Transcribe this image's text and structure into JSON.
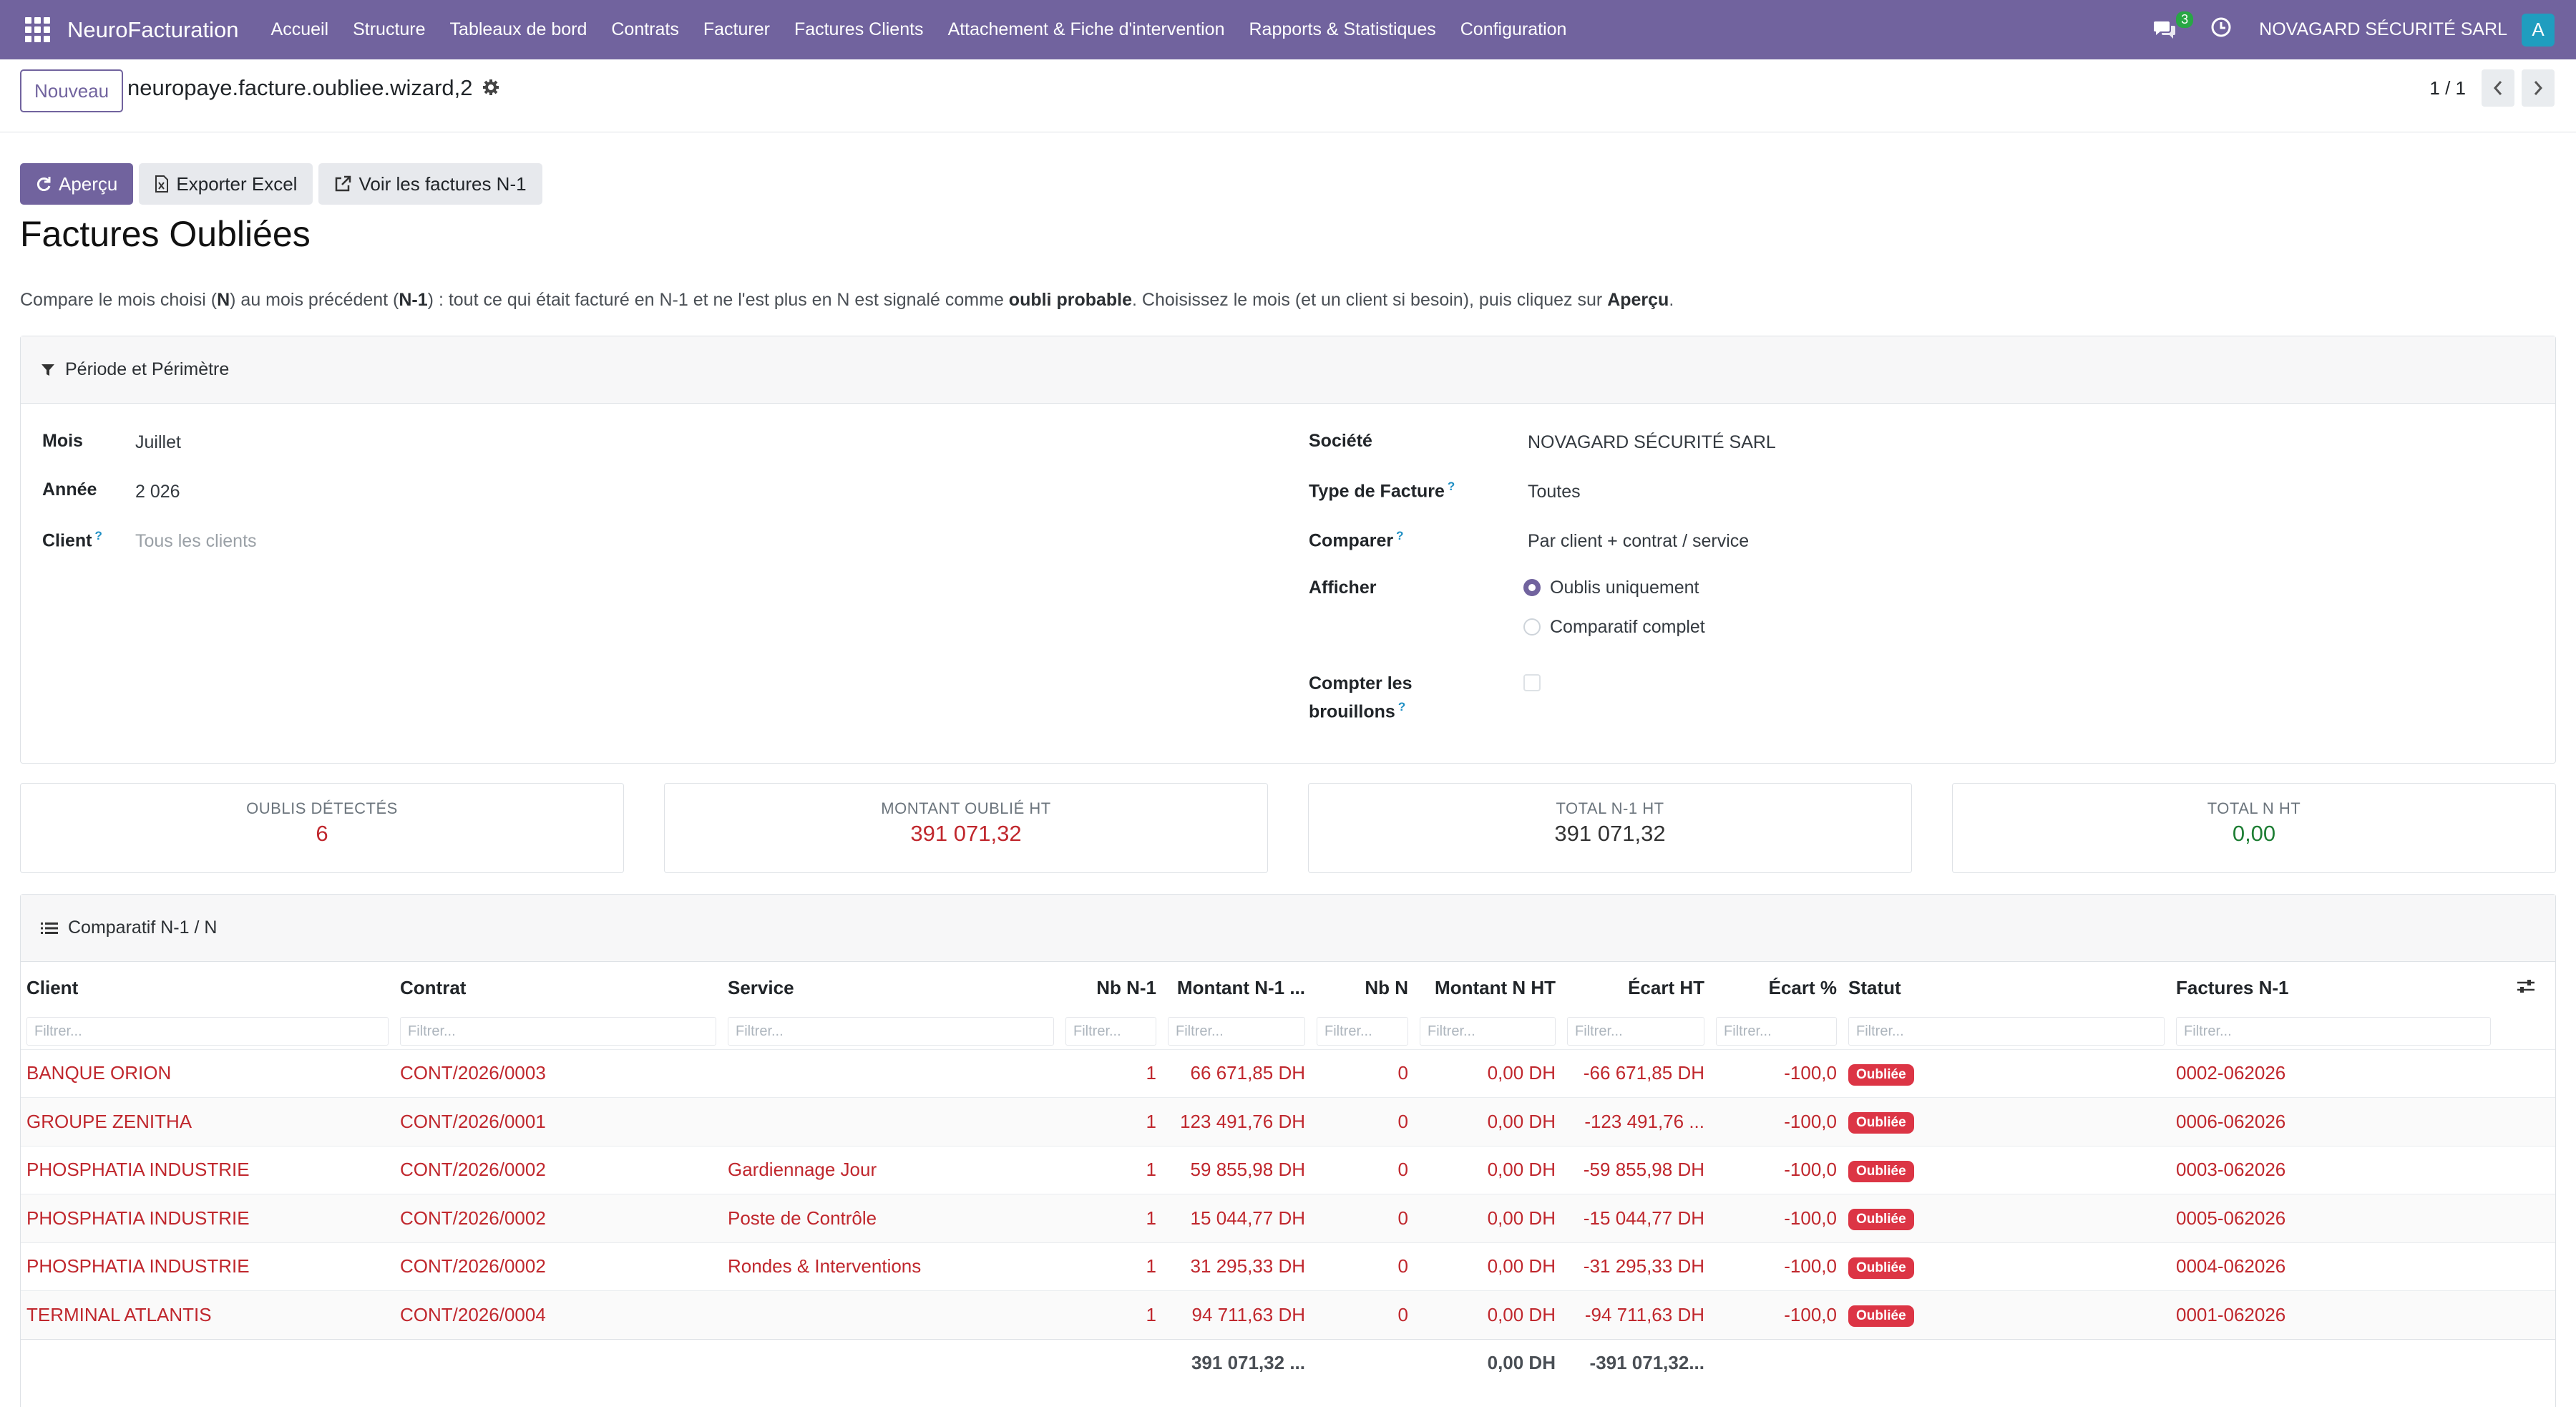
{
  "navbar": {
    "brand": "NeuroFacturation",
    "menu": [
      "Accueil",
      "Structure",
      "Tableaux de bord",
      "Contrats",
      "Facturer",
      "Factures Clients",
      "Attachement & Fiche d'intervention",
      "Rapports & Statistiques",
      "Configuration"
    ],
    "chat_count": "3",
    "company": "NOVAGARD SÉCURITÉ SARL",
    "avatar_letter": "A"
  },
  "control": {
    "new_label": "Nouveau",
    "record_name": "neuropaye.facture.oubliee.wizard,2",
    "pager": "1 / 1"
  },
  "actions": {
    "preview": "Aperçu",
    "export": "Exporter Excel",
    "view_n1": "Voir les factures N-1"
  },
  "page_title": "Factures Oubliées",
  "intro": {
    "p1": "Compare le mois choisi (",
    "b1": "N",
    "p2": ") au mois précédent (",
    "b2": "N-1",
    "p3": ") : tout ce qui était facturé en N-1 et ne l'est plus en N est signalé comme ",
    "b3": "oubli probable",
    "p4": ". Choisissez le mois (et un client si besoin), puis cliquez sur ",
    "b4": "Aperçu",
    "p5": "."
  },
  "section1": {
    "title": "Période et Périmètre",
    "mois_label": "Mois",
    "mois_value": "Juillet",
    "annee_label": "Année",
    "annee_value": "2 026",
    "client_label": "Client",
    "client_placeholder": "Tous les clients",
    "societe_label": "Société",
    "societe_value": "NOVAGARD SÉCURITÉ SARL",
    "type_label": "Type de Facture",
    "type_value": "Toutes",
    "comparer_label": "Comparer",
    "comparer_value": "Par client + contrat / service",
    "afficher_label": "Afficher",
    "radio1": "Oublis uniquement",
    "radio2": "Comparatif complet",
    "brouillons_label1": "Compter les",
    "brouillons_label2": "brouillons",
    "help_mark": "?"
  },
  "kpis": [
    {
      "label": "OUBLIS DÉTECTÉS",
      "value": "6",
      "color": "#c0272d"
    },
    {
      "label": "MONTANT OUBLIÉ HT",
      "value": "391 071,32",
      "color": "#c0272d"
    },
    {
      "label": "TOTAL N-1 HT",
      "value": "391 071,32",
      "color": "#333333"
    },
    {
      "label": "TOTAL N HT",
      "value": "0,00",
      "color": "#1e7e34"
    }
  ],
  "section2": {
    "title": "Comparatif N-1 / N",
    "columns": [
      "Client",
      "Contrat",
      "Service",
      "Nb N-1",
      "Montant N-1 ...",
      "Nb N",
      "Montant N HT",
      "Écart HT",
      "Écart %",
      "Statut",
      "Factures N-1"
    ],
    "filter_placeholder": "Filtrer...",
    "rows": [
      {
        "client": "BANQUE ORION",
        "contrat": "CONT/2026/0003",
        "service": "",
        "nb_n1": "1",
        "montant_n1": "66 671,85 DH",
        "nb_n": "0",
        "montant_n": "0,00 DH",
        "ecart": "-66 671,85 DH",
        "ecart_pct": "-100,0",
        "statut": "Oubliée",
        "factures": "0002-062026"
      },
      {
        "client": "GROUPE ZENITHA",
        "contrat": "CONT/2026/0001",
        "service": "",
        "nb_n1": "1",
        "montant_n1": "123 491,76 DH",
        "nb_n": "0",
        "montant_n": "0,00 DH",
        "ecart": "-123 491,76 ...",
        "ecart_pct": "-100,0",
        "statut": "Oubliée",
        "factures": "0006-062026"
      },
      {
        "client": "PHOSPHATIA INDUSTRIE",
        "contrat": "CONT/2026/0002",
        "service": "Gardiennage Jour",
        "nb_n1": "1",
        "montant_n1": "59 855,98 DH",
        "nb_n": "0",
        "montant_n": "0,00 DH",
        "ecart": "-59 855,98 DH",
        "ecart_pct": "-100,0",
        "statut": "Oubliée",
        "factures": "0003-062026"
      },
      {
        "client": "PHOSPHATIA INDUSTRIE",
        "contrat": "CONT/2026/0002",
        "service": "Poste de Contrôle",
        "nb_n1": "1",
        "montant_n1": "15 044,77 DH",
        "nb_n": "0",
        "montant_n": "0,00 DH",
        "ecart": "-15 044,77 DH",
        "ecart_pct": "-100,0",
        "statut": "Oubliée",
        "factures": "0005-062026"
      },
      {
        "client": "PHOSPHATIA INDUSTRIE",
        "contrat": "CONT/2026/0002",
        "service": "Rondes & Interventions",
        "nb_n1": "1",
        "montant_n1": "31 295,33 DH",
        "nb_n": "0",
        "montant_n": "0,00 DH",
        "ecart": "-31 295,33 DH",
        "ecart_pct": "-100,0",
        "statut": "Oubliée",
        "factures": "0004-062026"
      },
      {
        "client": "TERMINAL ATLANTIS",
        "contrat": "CONT/2026/0004",
        "service": "",
        "nb_n1": "1",
        "montant_n1": "94 711,63 DH",
        "nb_n": "0",
        "montant_n": "0,00 DH",
        "ecart": "-94 711,63 DH",
        "ecart_pct": "-100,0",
        "statut": "Oubliée",
        "factures": "0001-062026"
      }
    ],
    "totals": {
      "montant_n1": "391 071,32 ...",
      "montant_n": "0,00 DH",
      "ecart": "-391 071,32..."
    }
  }
}
